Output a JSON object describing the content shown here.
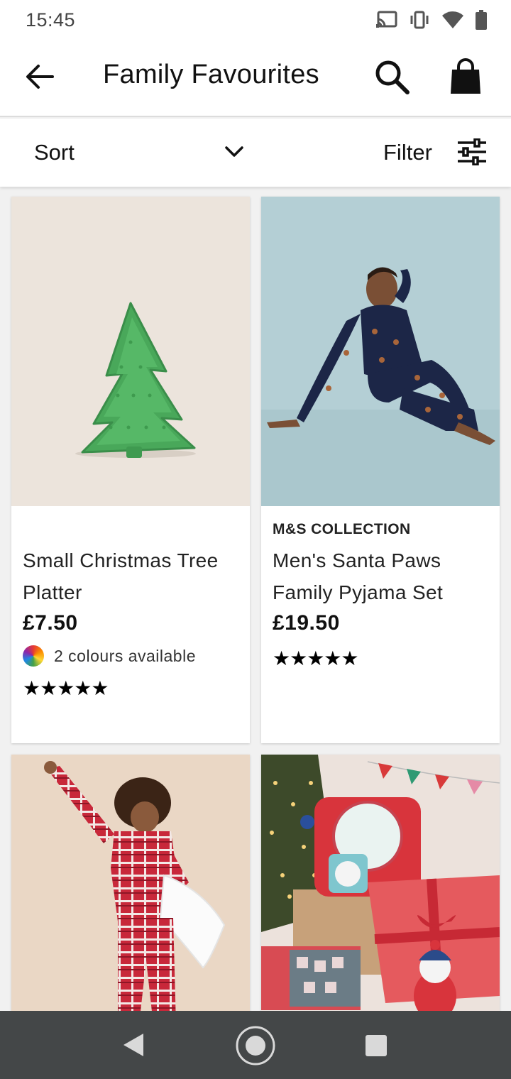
{
  "status_bar": {
    "time": "15:45",
    "icons": [
      "cast-icon",
      "vibrate-icon",
      "wifi-icon",
      "battery-icon"
    ]
  },
  "header": {
    "title": "Family Favourites",
    "back_icon": "arrow-left-icon",
    "search_icon": "search-icon",
    "bag_icon": "shopping-bag-icon"
  },
  "toolbar": {
    "sort_label": "Sort",
    "filter_label": "Filter"
  },
  "products": [
    {
      "brand": "",
      "name": "Small Christmas Tree Platter",
      "price": "£7.50",
      "colours": "2 colours available",
      "rating_stars": "★★★★★",
      "image": "christmas-tree-platter"
    },
    {
      "brand": "M&S COLLECTION",
      "name": "Men's Santa Paws Family Pyjama Set",
      "price": "£19.50",
      "rating_stars": "★★★★★",
      "image": "mens-pyjama-model"
    },
    {
      "image": "red-tartan-pyjama-model"
    },
    {
      "image": "christmas-gift-set"
    }
  ],
  "colors": {
    "background": "#f1f1f1",
    "card": "#ffffff",
    "nav_bar": "#444748"
  }
}
